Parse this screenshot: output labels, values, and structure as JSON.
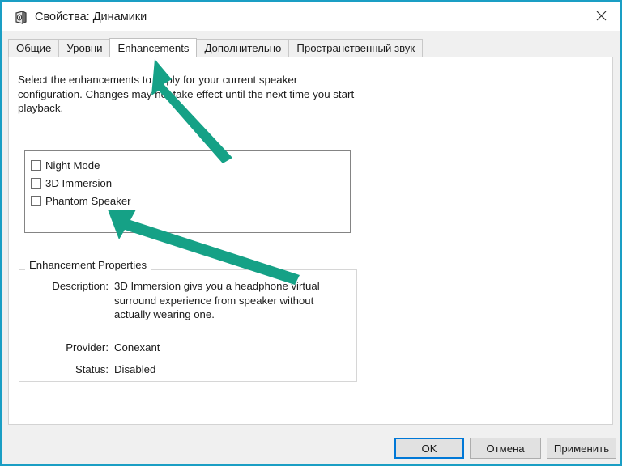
{
  "window": {
    "title": "Свойства: Динамики",
    "icon": "speaker-icon",
    "close_label": "✕",
    "accent_color": "#1a9ec4"
  },
  "tabs": [
    {
      "label": "Общие",
      "active": false
    },
    {
      "label": "Уровни",
      "active": false
    },
    {
      "label": "Enhancements",
      "active": true
    },
    {
      "label": "Дополнительно",
      "active": false
    },
    {
      "label": "Пространственный звук",
      "active": false
    }
  ],
  "content": {
    "intro": "Select the enhancements to apply for your current speaker configuration. Changes may not take effect until the next time you start playback.",
    "enhancements": [
      {
        "label": "Night Mode",
        "checked": false
      },
      {
        "label": "3D Immersion",
        "checked": false
      },
      {
        "label": "Phantom Speaker",
        "checked": false
      }
    ],
    "properties": {
      "group_title": "Enhancement Properties",
      "description_label": "Description:",
      "description_value": "3D Immersion givs you a headphone virtual surround experience from speaker without actually wearing one.",
      "provider_label": "Provider:",
      "provider_value": "Conexant",
      "status_label": "Status:",
      "status_value": "Disabled"
    }
  },
  "footer": {
    "ok_label": "OK",
    "cancel_label": "Отмена",
    "apply_label": "Применить"
  },
  "annotations": {
    "arrow_color": "#15a186",
    "arrow_1_target": "enhancements-tab",
    "arrow_2_target": "enhancement-list-box"
  }
}
